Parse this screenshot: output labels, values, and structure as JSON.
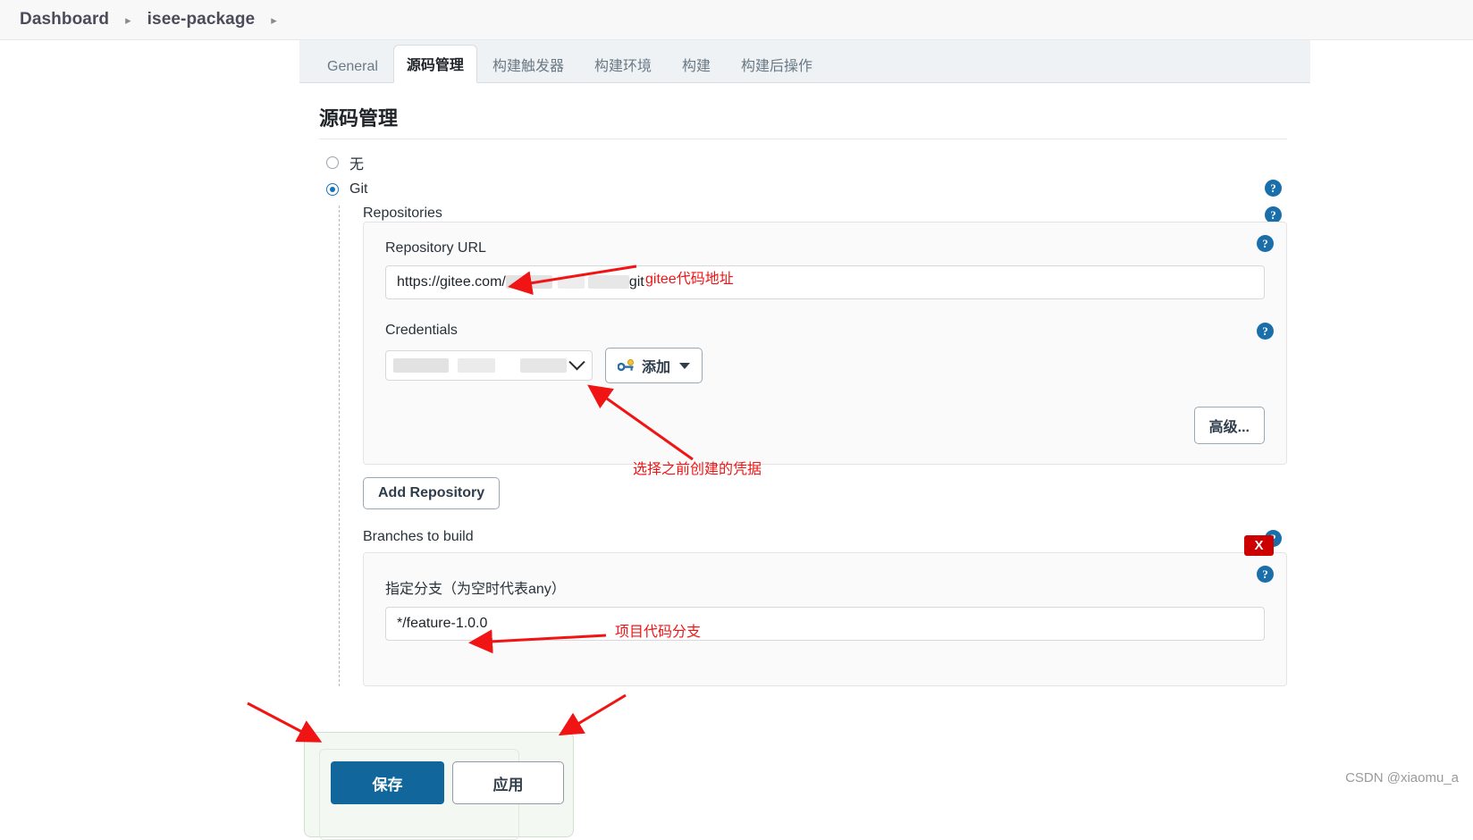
{
  "breadcrumb": {
    "items": [
      {
        "label": "Dashboard"
      },
      {
        "label": "isee-package"
      }
    ],
    "separator": "▸"
  },
  "tabs": [
    {
      "label": "General",
      "active": false
    },
    {
      "label": "源码管理",
      "active": true
    },
    {
      "label": "构建触发器",
      "active": false
    },
    {
      "label": "构建环境",
      "active": false
    },
    {
      "label": "构建",
      "active": false
    },
    {
      "label": "构建后操作",
      "active": false
    }
  ],
  "section": {
    "title": "源码管理",
    "scm_options": [
      {
        "label": "无",
        "checked": false
      },
      {
        "label": "Git",
        "checked": true
      }
    ]
  },
  "git": {
    "repositories_label": "Repositories",
    "repository_url_label": "Repository URL",
    "repository_url_prefix": "https://gitee.com/",
    "repository_url_suffix": "git",
    "credentials_label": "Credentials",
    "credentials_selected": "",
    "add_credentials_label": "添加",
    "advanced_label": "高级...",
    "add_repository_label": "Add Repository",
    "branches_label": "Branches to build",
    "branch_specifier_label": "指定分支（为空时代表any）",
    "branch_specifier_value": "*/feature-1.0.0",
    "delete_badge_label": "X"
  },
  "footer": {
    "save_label": "保存",
    "apply_label": "应用"
  },
  "annotations": [
    {
      "text": "gitee代码地址"
    },
    {
      "text": "选择之前创建的凭据"
    },
    {
      "text": "项目代码分支"
    }
  ],
  "help_icon_glyph": "?",
  "watermark": "CSDN @xiaomu_a",
  "colors": {
    "accent_blue": "#11679c",
    "help_blue": "#1a6fab",
    "annotation_red": "#f01414",
    "delete_red": "#cc0000"
  }
}
